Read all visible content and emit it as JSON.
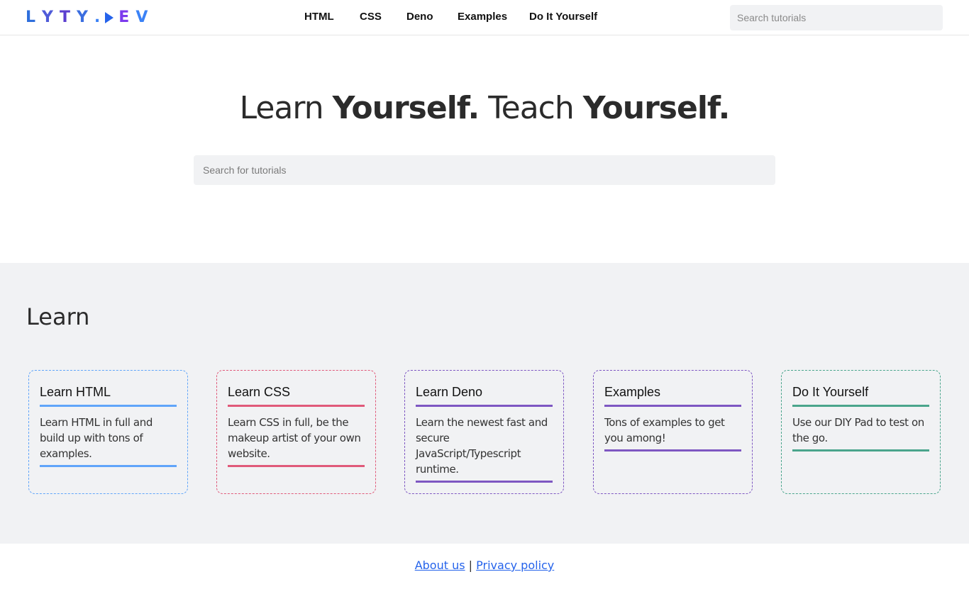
{
  "brand": {
    "logo_text": "LYTY.DEV",
    "logo_colors": [
      "#2f6fdc",
      "#5b4fd8",
      "#6a3fcf",
      "#2563eb",
      "#3b82f6",
      "#7c3aed",
      "#2563eb",
      "#3b82f6"
    ]
  },
  "nav": {
    "items": [
      {
        "label": "HTML"
      },
      {
        "label": "CSS"
      },
      {
        "label": "Deno"
      },
      {
        "label": "Examples"
      },
      {
        "label": "Do It Yourself"
      }
    ],
    "search_placeholder": "Search tutorials"
  },
  "hero": {
    "title_parts": [
      "Learn ",
      "Yourself.",
      " Teach ",
      "Yourself."
    ],
    "search_placeholder": "Search for tutorials"
  },
  "learn": {
    "heading": "Learn",
    "cards": [
      {
        "title": "Learn HTML",
        "description": "Learn HTML in full and build up with tons of examples.",
        "accent": "#60a5fa"
      },
      {
        "title": "Learn CSS",
        "description": "Learn CSS in full, be the makeup artist of your own website.",
        "accent": "#e05a7a"
      },
      {
        "title": "Learn Deno",
        "description": "Learn the newest fast and secure JavaScript/Typescript runtime.",
        "accent": "#7e57c2"
      },
      {
        "title": "Examples",
        "description": "Tons of examples to get you among!",
        "accent": "#7e57c2"
      },
      {
        "title": "Do It Yourself",
        "description": "Use our DIY Pad to test on the go.",
        "accent": "#4aa58c"
      }
    ]
  },
  "footer": {
    "about_label": "About us",
    "separator": "|",
    "privacy_label": "Privacy policy"
  }
}
